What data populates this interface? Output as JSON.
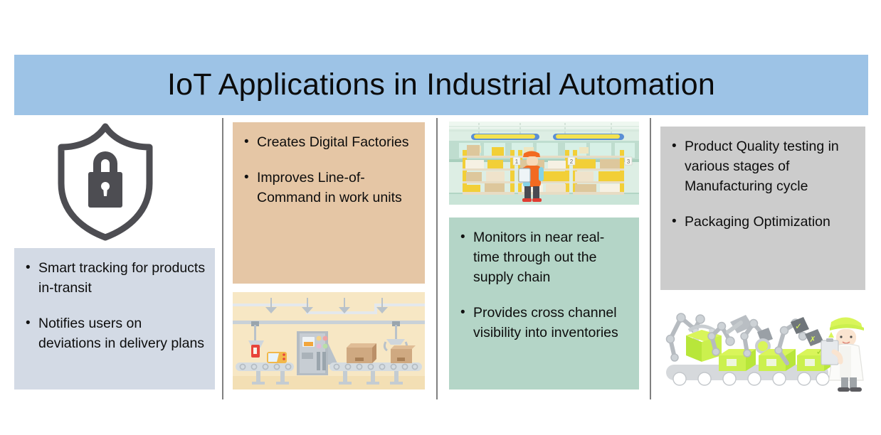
{
  "header": {
    "title": "IoT Applications in Industrial Automation",
    "background_color": "#9dc3e6",
    "text_color": "#0b0b0b"
  },
  "columns": [
    {
      "id": "security-tracking",
      "icon": "shield-lock-icon",
      "icon_color": "#4d4d52",
      "box_color": "#d3dae5",
      "bullets": [
        {
          "marker": "•",
          "text": "Smart tracking for products in-transit"
        },
        {
          "marker": "•",
          "text": "Notifies  users on deviations in delivery plans"
        }
      ]
    },
    {
      "id": "digital-factories",
      "box_color": "#e5c6a5",
      "bullets": [
        {
          "marker": "•",
          "text": "Creates   Digital Factories"
        },
        {
          "marker": "•",
          "text": "Improves Line-of-Command in work units"
        }
      ],
      "image": {
        "name": "factory-conveyor-illustration",
        "background_color": "#f6e6c3"
      }
    },
    {
      "id": "supply-chain-monitoring",
      "box_color": "#b4d5c7",
      "bullets": [
        {
          "marker": "•",
          "text": "Monitors in near real-time through out the supply chain"
        },
        {
          "marker": "•",
          "text": "Provides cross channel visibility into inventories"
        }
      ],
      "image": {
        "name": "warehouse-worker-illustration",
        "background_color": "#d9ecdf",
        "aisle_labels": [
          "1",
          "2",
          "3"
        ]
      }
    },
    {
      "id": "quality-packaging",
      "box_color": "#cccccc",
      "bullets": [
        {
          "marker": "•",
          "text": "Product Quality testing in various stages of Manufacturing cycle"
        },
        {
          "marker": "•",
          "text": "Packaging Optimization"
        }
      ],
      "image": {
        "name": "robotic-quality-inspection-illustration",
        "background_color": "#ffffff",
        "stamp_labels": [
          "✓",
          "✗"
        ]
      }
    }
  ]
}
